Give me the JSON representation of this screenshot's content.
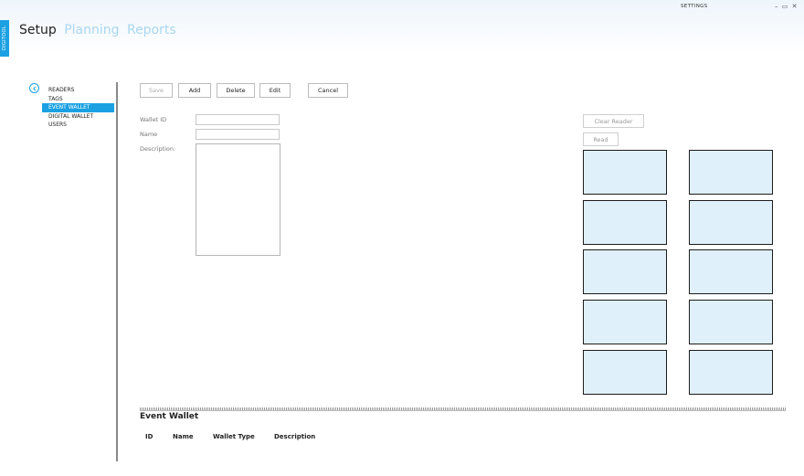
{
  "window": {
    "title": "SETTINGS",
    "controls": "– ▭ ✕",
    "side_tab": "DIGITOOL"
  },
  "nav": {
    "tabs": [
      {
        "label": "Setup",
        "active": true
      },
      {
        "label": "Planning",
        "active": false
      },
      {
        "label": "Reports",
        "active": false
      }
    ]
  },
  "sidebar": {
    "items": [
      {
        "label": "READERS"
      },
      {
        "label": "TAGS"
      },
      {
        "label": "EVENT WALLET",
        "selected": true
      },
      {
        "label": "DIGITAL WALLET"
      },
      {
        "label": "USERS"
      }
    ]
  },
  "toolbar": {
    "save": "Save",
    "add": "Add",
    "delete": "Delete",
    "edit": "Edit",
    "cancel": "Cancel"
  },
  "form": {
    "wallet_id_label": "Wallet ID",
    "wallet_id_value": "",
    "name_label": "Name",
    "name_value": "",
    "description_label": "Description:",
    "description_value": ""
  },
  "reader": {
    "clear_label": "Clear Reader",
    "read_label": "Read"
  },
  "table": {
    "title": "Event Wallet",
    "columns": [
      "ID",
      "Name",
      "Wallet Type",
      "Description"
    ]
  },
  "colors": {
    "accent": "#1ba1e2",
    "slot_fill": "#dff0fb",
    "nav_inactive": "#a9d7f0"
  }
}
